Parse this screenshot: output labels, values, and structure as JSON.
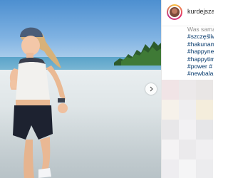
{
  "post": {
    "username": "kurdejszat",
    "caption_lines": [
      "Was sama",
      "#szczęśliw",
      "#hakunam",
      "#happyne",
      "#happytim",
      "#power #",
      "#newbala"
    ]
  },
  "icons": {
    "avatar": "avatar",
    "next": "chevron-right-icon"
  },
  "colors": {
    "link": "#003569",
    "muted": "#8e8e8e",
    "username": "#262626"
  }
}
